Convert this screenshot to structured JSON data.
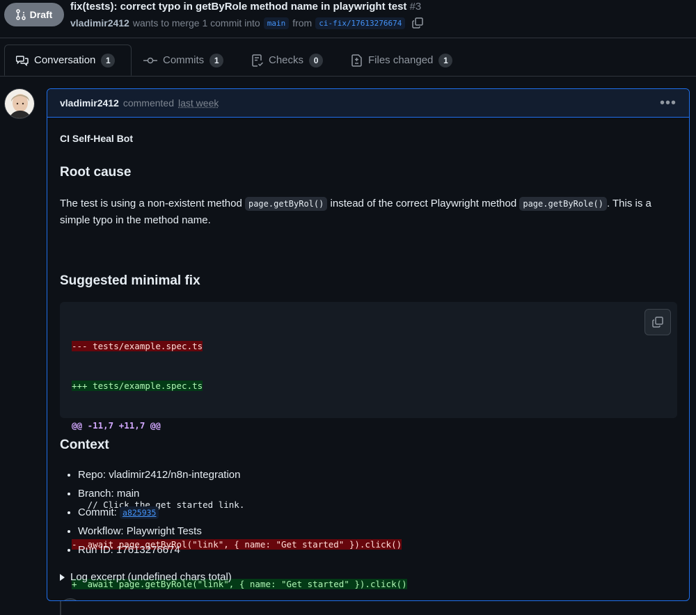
{
  "header": {
    "draft_label": "Draft",
    "title": "fix(tests): correct typo in getByRole method name in playwright test",
    "number": "#3",
    "author": "vladimir2412",
    "merge_text": "wants to merge 1 commit into",
    "base_branch": "main",
    "from_text": "from",
    "head_branch": "ci-fix/17613276674"
  },
  "tabs": [
    {
      "label": "Conversation",
      "count": "1",
      "icon": "comment-discussion-icon"
    },
    {
      "label": "Commits",
      "count": "1",
      "icon": "git-commit-icon"
    },
    {
      "label": "Checks",
      "count": "0",
      "icon": "checklist-icon"
    },
    {
      "label": "Files changed",
      "count": "1",
      "icon": "file-diff-icon"
    }
  ],
  "comment": {
    "author": "vladimir2412",
    "action": "commented",
    "when": "last week",
    "bot_name": "CI Self-Heal Bot",
    "root_cause_heading": "Root cause",
    "root_cause_p1": "The test is using a non-existent method",
    "root_cause_code1": "page.getByRol()",
    "root_cause_p2": "instead of the correct Playwright method",
    "root_cause_code2": "page.getByRole()",
    "root_cause_p3": ". This is a simple typo in the method name.",
    "fix_heading": "Suggested minimal fix",
    "diff": {
      "file_del": "--- tests/example.spec.ts",
      "file_add": "+++ tests/example.spec.ts",
      "hunk": "@@ -11,7 +11,7 @@",
      "context": "   // Click the get started link.",
      "line_del": "-  await page.getByRol(\"link\", { name: \"Get started\" }).click()",
      "line_add": "+  await page.getByRole(\"link\", { name: \"Get started\" }).click()"
    },
    "context_heading": "Context",
    "context_items": {
      "repo": "Repo: vladimir2412/n8n-integration",
      "branch": "Branch: main",
      "commit_label": "Commit:",
      "commit_sha": "a825935",
      "workflow": "Workflow: Playwright Tests",
      "run_id": "Run ID: 17613276674"
    },
    "details_summary": "Log excerpt (undefined chars total)"
  },
  "colors": {
    "background": "#0d1117",
    "accent_border": "#1f6feb",
    "link": "#4493f8",
    "draft_badge": "#6e7681"
  }
}
